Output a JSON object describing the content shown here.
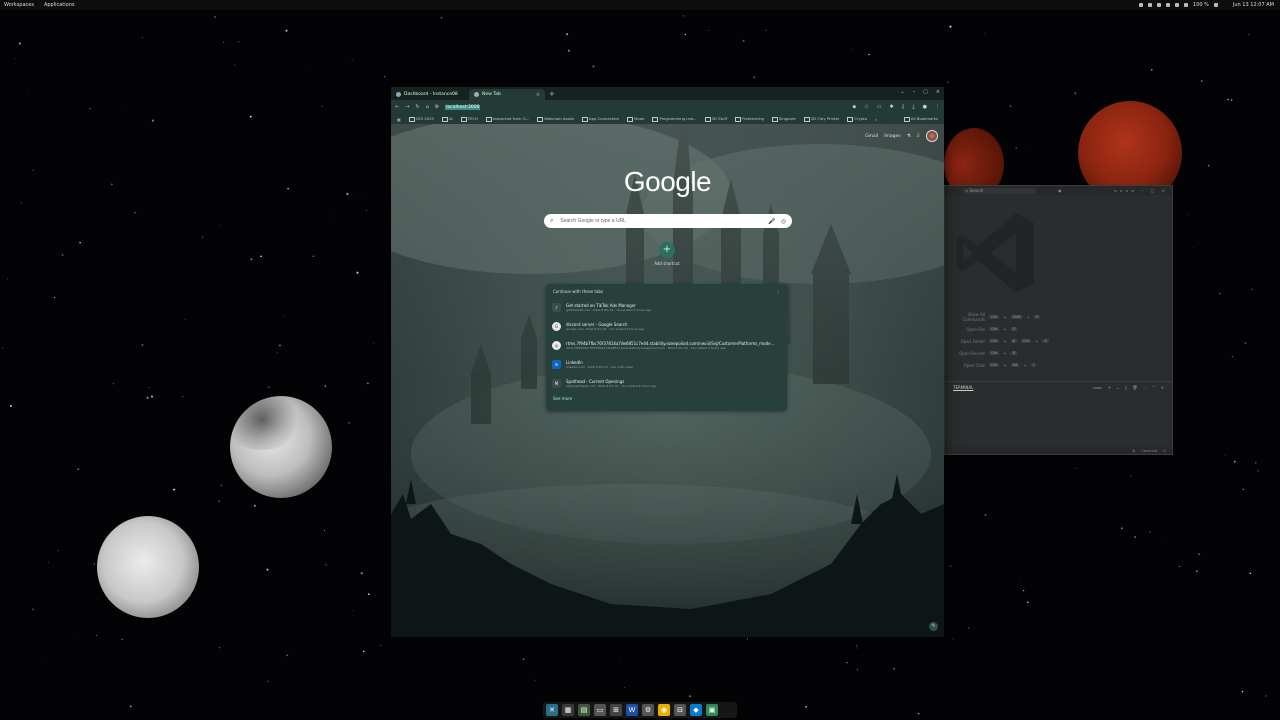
{
  "topbar": {
    "workspaces": "Workspaces",
    "applications": "Applications",
    "battery": "100 %",
    "datetime": "Jun 13  12:07 AM"
  },
  "chrome": {
    "tabs": [
      {
        "label": "Dashboard - Instance08",
        "active": false
      },
      {
        "label": "New Tab",
        "active": true
      }
    ],
    "omnibox_selected": "localhost:3000",
    "bookmarks": [
      "CES 2025",
      "AI",
      "TECH",
      "Inspected from G...",
      "Webclam Assist",
      "App Connection",
      "Moon",
      "Programming Lea...",
      "3D Stuff",
      "Freelancing",
      "Singpore",
      "3D Clay Printer",
      "Crypto"
    ],
    "bookmarks_overflow": "»",
    "all_bookmarks": "All Bookmarks"
  },
  "ntp": {
    "gmail": "Gmail",
    "images": "Images",
    "logo": "Google",
    "search_placeholder": "Search Google or type a URL",
    "add_shortcut": "Add shortcut",
    "continue": {
      "heading": "Continue with these tabs",
      "items": [
        {
          "title": "Get started on TikTok Ads Manager",
          "sub": "gettiktokad.com · Pixel 8 Pro 01 · You visited 5 hours ago",
          "icon": "♪"
        },
        {
          "title": "discord server - Google Search",
          "sub": "google.com · Pixel 8 Pro 01 · You visited 8 hours ago",
          "icon": "G"
        },
        {
          "title": "rtms.7f94b7fbc76f37814a7de6851c7e44.stability.ezeepoliod.com/neoiii/SnJ/CustomerPlatforms_mode...",
          "sub": "rtms.7f94b7fbc76f37814a7de6851c7e44.stability.ezeepoliod.com · Pixel 8 Pro 01 · You visited 4 hours ago",
          "icon": "◎"
        },
        {
          "title": "LinkedIn",
          "sub": "linkedin.com · Pixel 8 Pro 01 · Yes multi rides",
          "icon": "in"
        },
        {
          "title": "Spothead - Current Openings",
          "sub": "applyspothead.com · Pixel 8 Pro 01 · You visited 4 hours ago",
          "icon": "M"
        }
      ],
      "see_more": "See more"
    }
  },
  "vscode": {
    "search": "Search",
    "shortcuts": [
      {
        "label": "Show All Commands",
        "keys": [
          "Ctrl",
          "+",
          "Shift",
          "+",
          "P"
        ]
      },
      {
        "label": "Open File",
        "keys": [
          "Ctrl",
          "+",
          "O"
        ]
      },
      {
        "label": "Open Folder",
        "keys": [
          "Ctrl",
          "+",
          "K",
          "Ctrl",
          "+",
          "O"
        ]
      },
      {
        "label": "Open Recent",
        "keys": [
          "Ctrl",
          "+",
          "R"
        ]
      },
      {
        "label": "Open Chat",
        "keys": [
          "Ctrl",
          "+",
          "Alt",
          "+",
          "I"
        ]
      }
    ],
    "terminal_tab": "TERMINAL",
    "terminal_shell": "node",
    "status_items": [
      "⚙",
      "Continue",
      "⊙"
    ]
  },
  "dock": {
    "icons": [
      "cross-app-icon",
      "apps-grid-icon",
      "terminal-icon",
      "files-icon",
      "windows-icon",
      "word-icon",
      "settings-icon",
      "chrome-icon",
      "vm-icon",
      "vscode-icon",
      "monitor-icon"
    ]
  },
  "colors": {
    "chrome_tab": "#243a37",
    "ntp_card": "#28403c",
    "selection": "#3b8d8a",
    "red_moon": "#8a2410"
  }
}
